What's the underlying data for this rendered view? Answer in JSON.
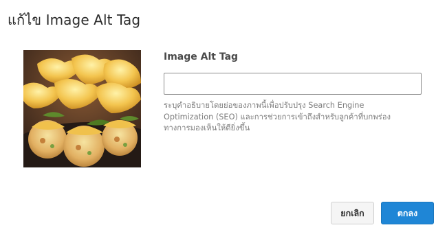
{
  "dialog": {
    "title": "แก้ไข Image Alt Tag"
  },
  "image": {
    "description": "food-thumbnail"
  },
  "form": {
    "label": "Image Alt Tag",
    "value": "",
    "placeholder": "",
    "help_lines": [
      "ระบุคำอธิบายโดยย่อของภาพนี้เพื่อปรับปรุง Search Engine",
      "Optimization (SEO) และการช่วยการเข้าถึงสำหรับลูกค้าที่บกพร่อง",
      "ทางการมองเห็นให้ดียิ่งขึ้น"
    ]
  },
  "buttons": {
    "cancel_label": "ยกเลิก",
    "ok_label": "ตกลง"
  },
  "colors": {
    "primary": "#1f86d6",
    "cancel_bg": "#f5f5f5",
    "text": "#2b2b2b",
    "help_text": "#7b7b7b"
  }
}
